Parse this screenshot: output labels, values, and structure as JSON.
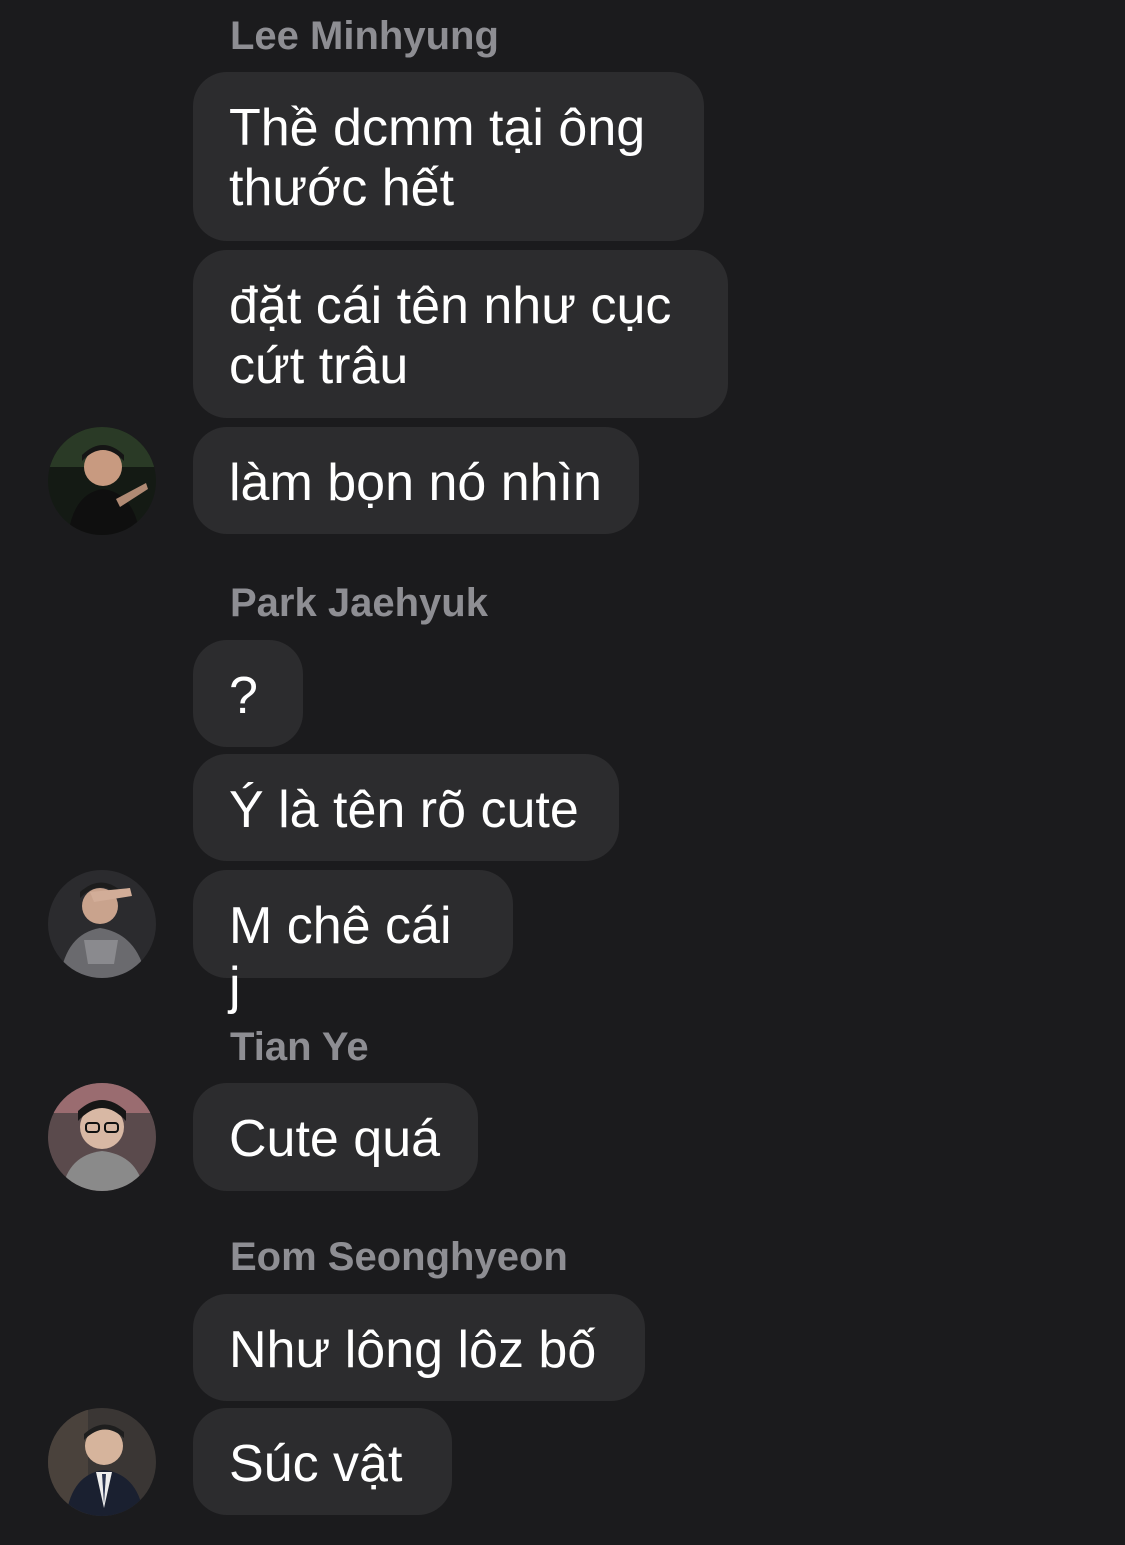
{
  "thread": {
    "groups": [
      {
        "sender": "Lee Minhyung",
        "messages": [
          "Thề dcmm tại ông\nthước hết",
          "đặt cái tên như cục\ncứt trâu",
          "làm bọn nó nhìn"
        ]
      },
      {
        "sender": "Park Jaehyuk",
        "messages": [
          "?",
          "Ý là tên rõ cute",
          "M chê cái j"
        ]
      },
      {
        "sender": "Tian Ye",
        "messages": [
          "Cute quá"
        ]
      },
      {
        "sender": "Eom Seonghyeon",
        "messages": [
          "Như lông lôz bố",
          "Súc vật"
        ]
      }
    ]
  },
  "colors": {
    "background": "#1b1b1d",
    "bubble": "#2c2c2e",
    "sender_name": "#8e8e93",
    "message_text": "#ffffff"
  }
}
